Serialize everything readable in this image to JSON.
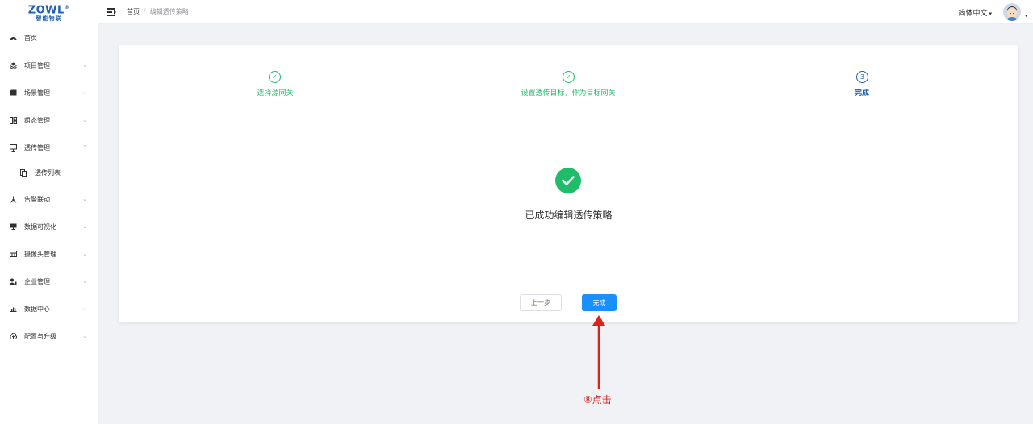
{
  "app": {
    "logo_text": "ZOWL",
    "logo_reg": "®",
    "logo_subtitle": "智能物联"
  },
  "sidebar": {
    "items": [
      {
        "label": "首页",
        "icon": "dashboard-icon",
        "has_arrow": false
      },
      {
        "label": "项目管理",
        "icon": "project-icon",
        "has_arrow": true,
        "arrow": "⌄"
      },
      {
        "label": "场景管理",
        "icon": "scene-icon",
        "has_arrow": true,
        "arrow": "⌄"
      },
      {
        "label": "组态管理",
        "icon": "config-icon",
        "has_arrow": true,
        "arrow": "⌄"
      },
      {
        "label": "透传管理",
        "icon": "monitor-icon",
        "has_arrow": true,
        "arrow": "⌃",
        "expanded": true
      },
      {
        "label": "透传列表",
        "icon": "list-icon",
        "has_arrow": false,
        "sub": true
      },
      {
        "label": "告警联动",
        "icon": "alarm-icon",
        "has_arrow": true,
        "arrow": "⌄"
      },
      {
        "label": "数据可视化",
        "icon": "visual-icon",
        "has_arrow": true,
        "arrow": "⌄"
      },
      {
        "label": "摄像头管理",
        "icon": "camera-icon",
        "has_arrow": true,
        "arrow": "⌄"
      },
      {
        "label": "企业管理",
        "icon": "enterprise-icon",
        "has_arrow": true,
        "arrow": "⌄"
      },
      {
        "label": "数据中心",
        "icon": "chart-icon",
        "has_arrow": true,
        "arrow": "⌄"
      },
      {
        "label": "配置与升级",
        "icon": "upgrade-icon",
        "has_arrow": true,
        "arrow": "⌄"
      }
    ]
  },
  "header": {
    "breadcrumb_home": "首页",
    "breadcrumb_sep": "/",
    "breadcrumb_current": "编辑透传策略",
    "language": "简体中文",
    "language_caret": "▾",
    "avatar_caret": "▾"
  },
  "steps": [
    {
      "label": "选择源网关",
      "status": "finished",
      "check": "✓"
    },
    {
      "label": "设置透传目标，作为目标网关",
      "status": "finished",
      "check": "✓"
    },
    {
      "label": "完成",
      "status": "process",
      "number": "3"
    }
  ],
  "result": {
    "message": "已成功编辑透传策略"
  },
  "buttons": {
    "prev": "上一步",
    "done": "完成"
  },
  "annotation": {
    "text": "⑧点击"
  },
  "colors": {
    "success": "#1fbd6a",
    "primary": "#1890ff",
    "step_current": "#1f5fb4",
    "annotation": "#d9241b"
  }
}
